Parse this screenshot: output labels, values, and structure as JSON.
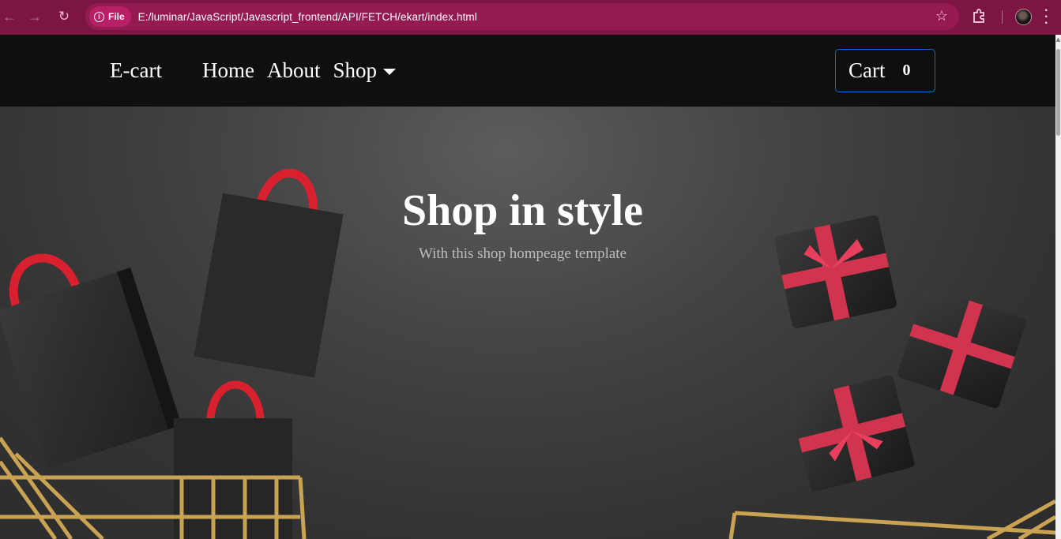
{
  "browser": {
    "back_icon": "arrow-left-icon",
    "forward_icon": "arrow-right-icon",
    "reload_icon": "reload-icon",
    "chip_label": "File",
    "url": "E:/luminar/JavaScript/Javascript_frontend/API/FETCH/ekart/index.html",
    "accent_color": "#7d1543"
  },
  "navbar": {
    "brand": "E-cart",
    "links": [
      "Home",
      "About",
      "Shop"
    ],
    "cart_label": "Cart",
    "cart_count": "0",
    "cart_border_color": "#1a63d8"
  },
  "hero": {
    "title": "Shop in style",
    "subtitle": "With this shop hompeage template"
  }
}
